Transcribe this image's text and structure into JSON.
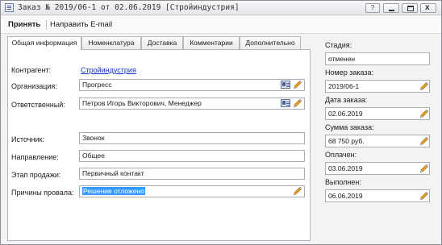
{
  "window": {
    "title": "Заказ № 2019/06-1 от 02.06.2019 [Стройиндустрия]",
    "buttons": {
      "help": "?",
      "close": "x"
    }
  },
  "toolbar": {
    "accept": "Принять",
    "send_email": "Направить E-mail"
  },
  "tabs": [
    {
      "label": "Общая информация",
      "active": true
    },
    {
      "label": "Номенклатура"
    },
    {
      "label": "Доставка"
    },
    {
      "label": "Комментарии"
    },
    {
      "label": "Дополнительно"
    }
  ],
  "form": {
    "contractor": {
      "label": "Контрагент:",
      "value": "Стройиндустрия"
    },
    "organization": {
      "label": "Организация:",
      "value": "Прогресс"
    },
    "responsible": {
      "label": "Ответственный:",
      "value": "Петров Игорь Викторович, Менеджер"
    },
    "source": {
      "label": "Источник:",
      "value": "Звонок"
    },
    "direction": {
      "label": "Направление:",
      "value": "Общее"
    },
    "sales_stage": {
      "label": "Этап продажи:",
      "value": "Первичный контакт"
    },
    "failure_reasons": {
      "label": "Причины провала:",
      "value": "Решение отложено"
    }
  },
  "side": {
    "stage": {
      "label": "Стадия:",
      "value": "отменен"
    },
    "order_number": {
      "label": "Номер заказа:",
      "value": "2019/06-1"
    },
    "order_date": {
      "label": "Дата заказа:",
      "value": "02.06.2019"
    },
    "order_sum": {
      "label": "Сумма заказа:",
      "value": "68 750 руб."
    },
    "paid": {
      "label": "Оплачен:",
      "value": "03.06.2019"
    },
    "completed": {
      "label": "Выполнен:",
      "value": "06.06.2019"
    }
  },
  "colors": {
    "accent_link": "#1033cc",
    "selection": "#3399ff",
    "pencil": "#e8a020"
  },
  "icons": [
    "window-icon",
    "contact-card-icon",
    "pencil-icon"
  ]
}
